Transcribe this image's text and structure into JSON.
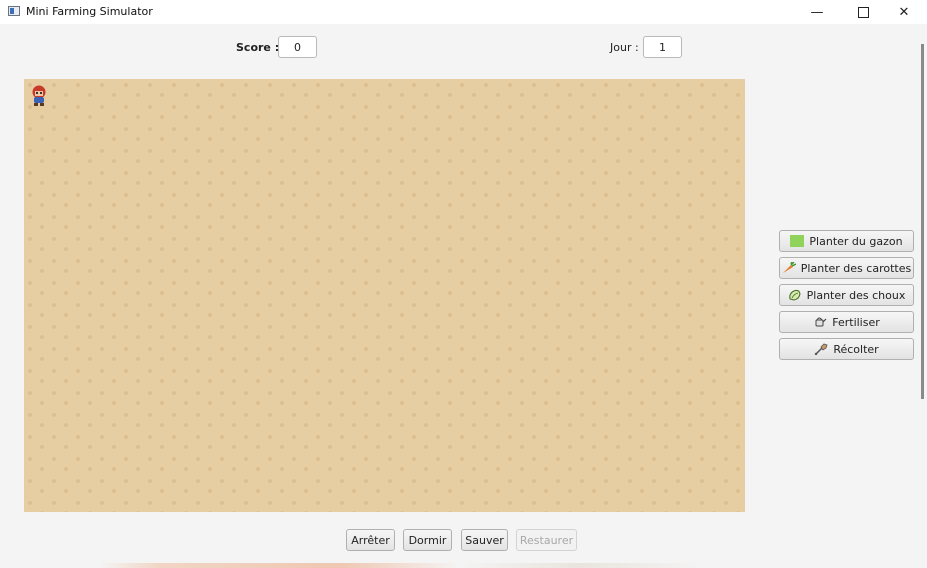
{
  "window": {
    "title": "Mini Farming Simulator"
  },
  "stats": {
    "score_label": "Score :",
    "score_value": "0",
    "day_label": "Jour :",
    "day_value": "1"
  },
  "actions": [
    {
      "label": "Planter du gazon",
      "icon": "grass-icon"
    },
    {
      "label": "Planter des carottes",
      "icon": "carrot-icon"
    },
    {
      "label": "Planter des choux",
      "icon": "cabbage-icon"
    },
    {
      "label": "Fertiliser",
      "icon": "watering-can-icon"
    },
    {
      "label": "Récolter",
      "icon": "shovel-icon"
    }
  ],
  "bottom_buttons": {
    "stop": "Arrêter",
    "sleep": "Dormir",
    "save": "Sauver",
    "restore": "Restaurer"
  },
  "colors": {
    "field": "#e7cda2",
    "grass": "#8fd35a",
    "carrot": "#e8782a"
  }
}
